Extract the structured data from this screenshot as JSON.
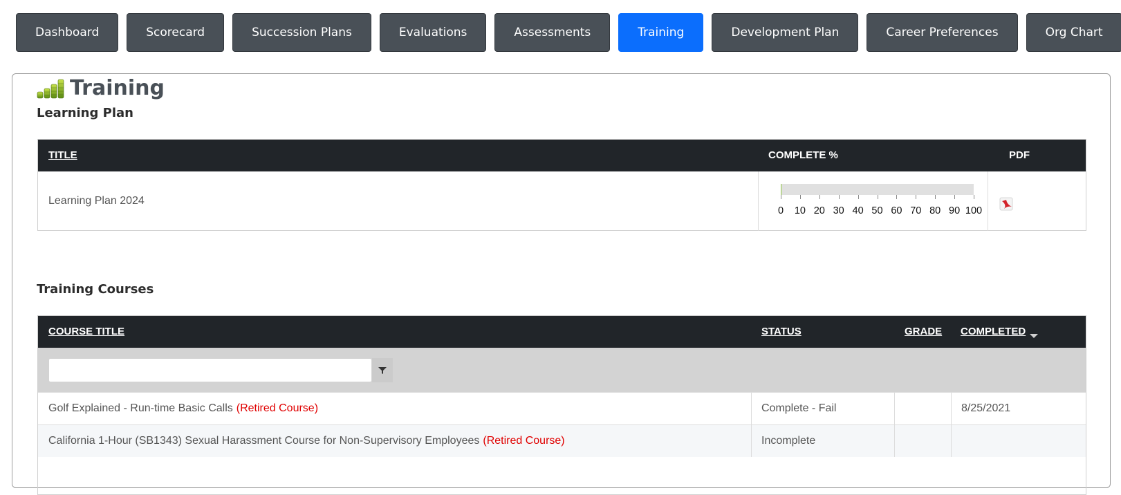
{
  "tabs": [
    {
      "label": "Dashboard"
    },
    {
      "label": "Scorecard"
    },
    {
      "label": "Succession Plans"
    },
    {
      "label": "Evaluations"
    },
    {
      "label": "Assessments"
    },
    {
      "label": "Training",
      "active": true
    },
    {
      "label": "Development Plan"
    },
    {
      "label": "Career Preferences"
    },
    {
      "label": "Org Chart"
    }
  ],
  "page": {
    "title": "Training",
    "icon": "stacked-coins-icon"
  },
  "learning_plan": {
    "heading": "Learning Plan",
    "columns": {
      "title": "TITLE",
      "complete": "COMPLETE %",
      "pdf": "PDF"
    },
    "rows": [
      {
        "title": "Learning Plan 2024",
        "complete_percent": 0.5,
        "pdf_icon": "pdf-icon"
      }
    ],
    "scale_labels": [
      "0",
      "10",
      "20",
      "30",
      "40",
      "50",
      "60",
      "70",
      "80",
      "90",
      "100"
    ],
    "accent_color": "#8dc63f"
  },
  "training_courses": {
    "heading": "Training Courses",
    "columns": {
      "course_title": "COURSE TITLE",
      "status": "STATUS",
      "grade": "GRADE",
      "completed": "COMPLETED"
    },
    "filter": {
      "value": "",
      "placeholder": "",
      "icon": "filter-icon"
    },
    "rows": [
      {
        "title": "Golf Explained - Run-time Basic Calls",
        "tag": "(Retired Course)",
        "status": "Complete - Fail",
        "grade": "",
        "completed": "8/25/2021"
      },
      {
        "title": "California 1-Hour (SB1343) Sexual Harassment Course for Non-Supervisory Employees",
        "tag": "(Retired Course)",
        "status": "Incomplete",
        "grade": "",
        "completed": ""
      }
    ]
  },
  "colors": {
    "tab": "#495057",
    "tab_active": "#0b6efd",
    "header_bg": "#212529",
    "retired": "#e00000"
  }
}
